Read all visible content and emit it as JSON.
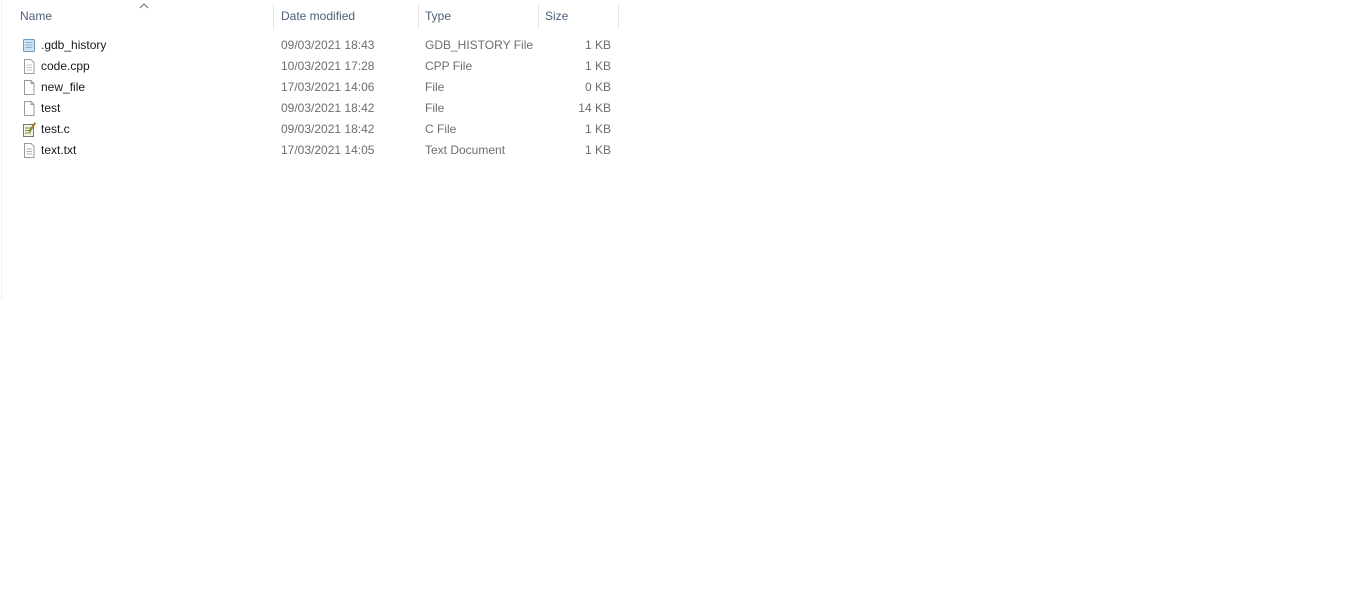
{
  "columns": {
    "name": "Name",
    "date": "Date modified",
    "type": "Type",
    "size": "Size"
  },
  "sort_indicator": "^",
  "files": [
    {
      "name": ".gdb_history",
      "date": "09/03/2021 18:43",
      "type": "GDB_HISTORY File",
      "size": "1 KB",
      "icon": "generic-file-icon"
    },
    {
      "name": "code.cpp",
      "date": "10/03/2021 17:28",
      "type": "CPP File",
      "size": "1 KB",
      "icon": "text-file-icon"
    },
    {
      "name": "new_file",
      "date": "17/03/2021 14:06",
      "type": "File",
      "size": "0 KB",
      "icon": "blank-file-icon"
    },
    {
      "name": "test",
      "date": "09/03/2021 18:42",
      "type": "File",
      "size": "14 KB",
      "icon": "blank-file-icon"
    },
    {
      "name": "test.c",
      "date": "09/03/2021 18:42",
      "type": "C File",
      "size": "1 KB",
      "icon": "c-source-file-icon"
    },
    {
      "name": "text.txt",
      "date": "17/03/2021 14:05",
      "type": "Text Document",
      "size": "1 KB",
      "icon": "text-file-icon"
    }
  ]
}
